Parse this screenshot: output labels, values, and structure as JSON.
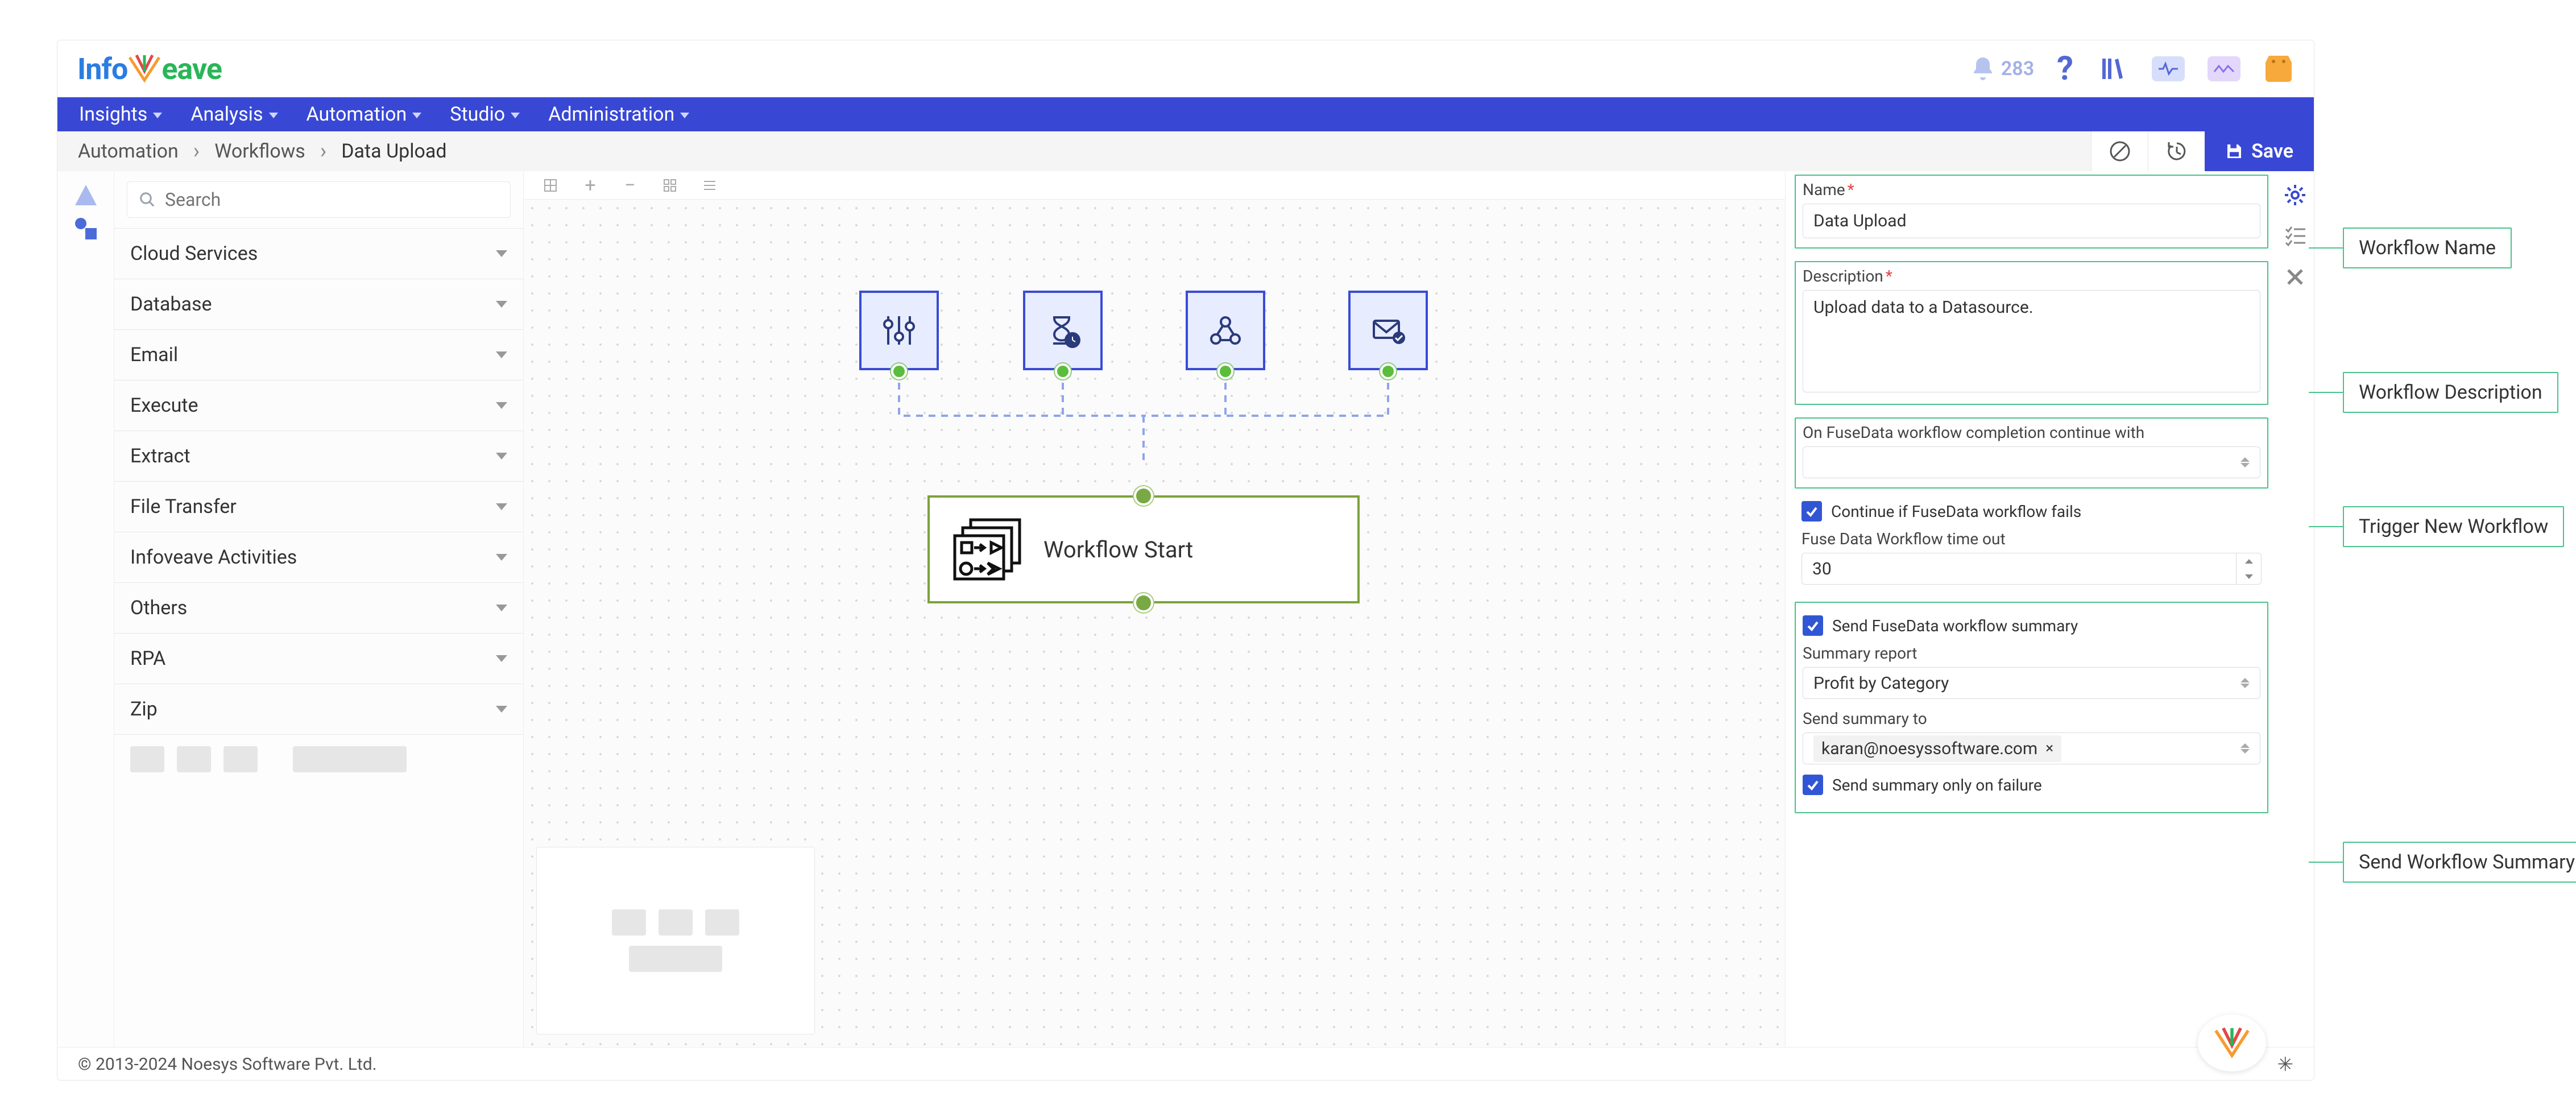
{
  "logo": {
    "left": "Info",
    "right": "eave"
  },
  "notifications": "283",
  "nav": [
    "Insights",
    "Analysis",
    "Automation",
    "Studio",
    "Administration"
  ],
  "breadcrumbs": [
    "Automation",
    "Workflows",
    "Data Upload"
  ],
  "save_label": "Save",
  "search": {
    "placeholder": "Search"
  },
  "sidebar_panels": [
    "Cloud Services",
    "Database",
    "Email",
    "Execute",
    "Extract",
    "File Transfer",
    "Infoveave Activities",
    "Others",
    "RPA",
    "Zip"
  ],
  "workflow_start_label": "Workflow Start",
  "canvas_nodes": [
    "settings",
    "hourglass-time",
    "webhook-loop",
    "email-check"
  ],
  "props": {
    "name_label": "Name",
    "name_value": "Data Upload",
    "desc_label": "Description",
    "desc_value": "Upload data to a Datasource.",
    "continue_label": "On FuseData workflow completion continue with",
    "continue_fail": "Continue if FuseData workflow fails",
    "timeout_label": "Fuse Data Workflow time out",
    "timeout_value": "30",
    "send_summary": "Send FuseData workflow summary",
    "summary_report_label": "Summary report",
    "summary_report_value": "Profit by Category",
    "send_to_label": "Send summary to",
    "send_to_email": "karan@noesyssoftware.com",
    "summary_fail_only": "Send summary only on failure"
  },
  "callouts": {
    "name": "Workflow Name",
    "desc": "Workflow Description",
    "trigger": "Trigger New Workflow",
    "summary": "Send Workflow Summary"
  },
  "copyright": "© 2013-2024 Noesys Software Pvt. Ltd."
}
